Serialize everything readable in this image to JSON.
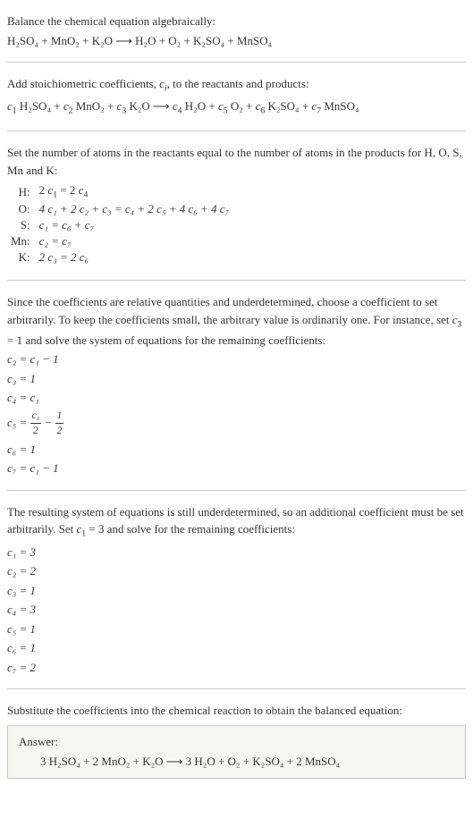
{
  "intro": {
    "line1": "Balance the chemical equation algebraically:",
    "eq": "H₂SO₄ + MnO₂ + K₂O ⟶ H₂O + O₂ + K₂SO₄ + MnSO₄"
  },
  "stoich": {
    "line1_a": "Add stoichiometric coefficients, ",
    "line1_ci": "c",
    "line1_i": "i",
    "line1_b": ", to the reactants and products:",
    "eq_parts": {
      "c1": "c",
      "i1": "1",
      "s1": " H₂SO₄ + ",
      "c2": "c",
      "i2": "2",
      "s2": " MnO₂ + ",
      "c3": "c",
      "i3": "3",
      "s3": " K₂O ⟶ ",
      "c4": "c",
      "i4": "4",
      "s4": " H₂O + ",
      "c5": "c",
      "i5": "5",
      "s5": " O₂ + ",
      "c6": "c",
      "i6": "6",
      "s6": " K₂SO₄ + ",
      "c7": "c",
      "i7": "7",
      "s7": " MnSO₄"
    }
  },
  "atoms": {
    "line1": "Set the number of atoms in the reactants equal to the number of atoms in the products for H, O, S, Mn and K:",
    "rows": [
      {
        "el": "H:",
        "lhs_a": "2 ",
        "lhs_c": "c",
        "lhs_i": "1",
        "mid": " = 2 ",
        "rhs_c": "c",
        "rhs_i": "4",
        "tail": ""
      },
      {
        "el": "O:",
        "full": "4 c₁ + 2 c₂ + c₃ = c₄ + 2 c₅ + 4 c₆ + 4 c₇"
      },
      {
        "el": "S:",
        "full": "c₁ = c₆ + c₇"
      },
      {
        "el": "Mn:",
        "full": "c₂ = c₇"
      },
      {
        "el": "K:",
        "full": "2 c₃ = 2 c₆"
      }
    ]
  },
  "under1": {
    "para_a": "Since the coefficients are relative quantities and underdetermined, choose a coefficient to set arbitrarily. To keep the coefficients small, the arbitrary value is ordinarily one. For instance, set ",
    "para_c": "c",
    "para_i": "3",
    "para_b": " = 1 and solve the system of equations for the remaining coefficients:",
    "lines": [
      "c₂ = c₁ − 1",
      "c₃ = 1",
      "c₄ = c₁"
    ],
    "c5_lhs": "c₅ = ",
    "c5_num1": "c₁",
    "c5_den1": "2",
    "c5_minus": " − ",
    "c5_num2": "1",
    "c5_den2": "2",
    "lines2": [
      "c₆ = 1",
      "c₇ = c₁ − 1"
    ]
  },
  "under2": {
    "para_a": "The resulting system of equations is still underdetermined, so an additional coefficient must be set arbitrarily. Set ",
    "para_c": "c",
    "para_i": "1",
    "para_b": " = 3 and solve for the remaining coefficients:",
    "lines": [
      "c₁ = 3",
      "c₂ = 2",
      "c₃ = 1",
      "c₄ = 3",
      "c₅ = 1",
      "c₆ = 1",
      "c₇ = 2"
    ]
  },
  "final": {
    "line1": "Substitute the coefficients into the chemical reaction to obtain the balanced equation:"
  },
  "answer": {
    "label": "Answer:",
    "eq": "3 H₂SO₄ + 2 MnO₂ + K₂O ⟶ 3 H₂O + O₂ + K₂SO₄ + 2 MnSO₄"
  }
}
